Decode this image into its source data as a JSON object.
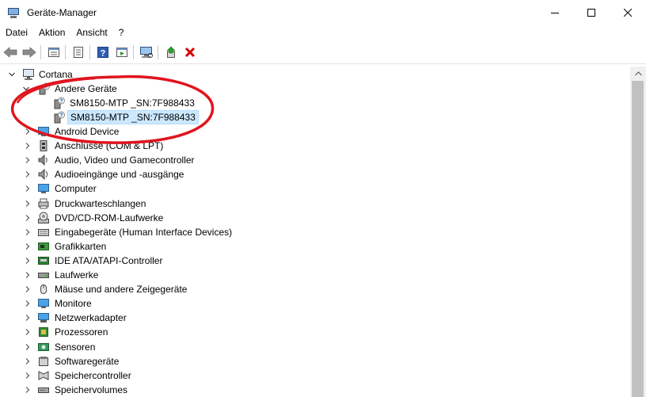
{
  "window": {
    "title": "Geräte-Manager",
    "controls": [
      "minimize",
      "maximize",
      "close"
    ]
  },
  "menu": {
    "items": [
      "Datei",
      "Aktion",
      "Ansicht",
      "?"
    ]
  },
  "toolbar": {
    "buttons": [
      "back-icon",
      "forward-icon",
      "properties-view-icon",
      "details-icon",
      "help-icon",
      "show-hidden-icon",
      "scan-hardware-icon",
      "update-driver-icon",
      "uninstall-icon"
    ]
  },
  "tree": {
    "root": "Cortana",
    "expanded_category": "Andere Geräte",
    "unknown_devices": [
      {
        "label": "SM8150-MTP _SN:7F988433",
        "selected": false
      },
      {
        "label": "SM8150-MTP _SN:7F988433",
        "selected": true
      }
    ],
    "categories": [
      "Android Device",
      "Anschlüsse (COM & LPT)",
      "Audio, Video und Gamecontroller",
      "Audioeingänge und -ausgänge",
      "Computer",
      "Druckwarteschlangen",
      "DVD/CD-ROM-Laufwerke",
      "Eingabegeräte (Human Interface Devices)",
      "Grafikkarten",
      "IDE ATA/ATAPI-Controller",
      "Laufwerke",
      "Mäuse und andere Zeigegeräte",
      "Monitore",
      "Netzwerkadapter",
      "Prozessoren",
      "Sensoren",
      "Softwaregeräte",
      "Speichercontroller",
      "Speichervolumes"
    ]
  },
  "colors": {
    "selection": "#cce8ff",
    "annotation": "#e0141e",
    "uninstall": "#d40000"
  }
}
